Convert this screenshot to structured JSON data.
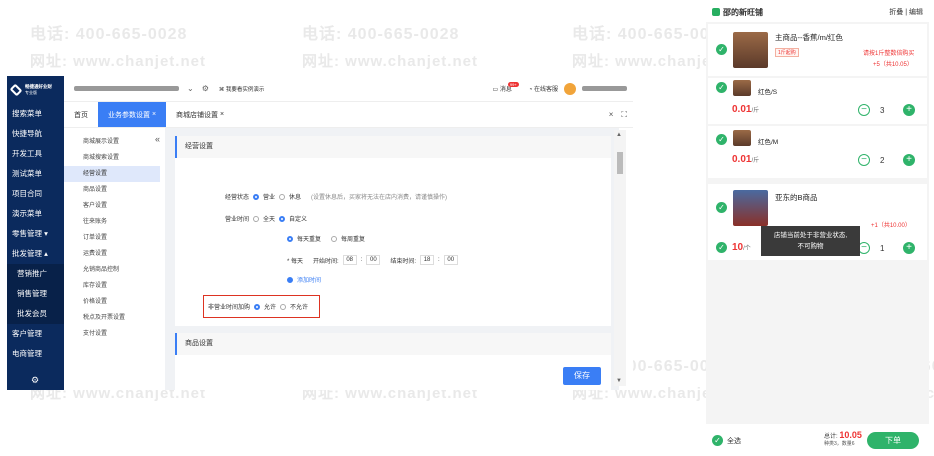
{
  "watermark": {
    "phone": "电话: 400-665-0028",
    "web": "网址: www.chanjet.net"
  },
  "app": {
    "logo_text": "畅捷通好业财",
    "logo_sub": "专业版",
    "nav": [
      "搜索菜单",
      "快捷导航",
      "开发工具",
      "测试菜单",
      "项目合同",
      "演示菜单",
      "零售管理",
      "批发管理",
      "营销推广",
      "销售管理",
      "批发会员",
      "客户管理",
      "电商管理"
    ],
    "nav_arrows": {
      "retail": "▾",
      "wholesale": "▴"
    },
    "topbar": {
      "example": "我要看实例演示",
      "msg": "消息",
      "badge": "99+",
      "service": "在线客服"
    },
    "tabs": [
      "首页",
      "业务参数设置",
      "商城店铺设置"
    ],
    "tab_close": "×",
    "submenu": [
      "商城展示设置",
      "商城搜索设置",
      "经营设置",
      "商品设置",
      "客户设置",
      "往来账务",
      "订单设置",
      "运费设置",
      "允销商品控制",
      "库存设置",
      "价格设置",
      "税点及开票设置",
      "支付设置"
    ],
    "active_sub": "经营设置",
    "collapse": "«",
    "section1_title": "经营设置",
    "status_label": "经营状态",
    "status_options": [
      "营业",
      "休息"
    ],
    "status_hint": "(设置休息后，买家将无法在店内消费，请谨慎操作)",
    "hours_label": "营业时间",
    "hours_options": [
      "全天",
      "自定义"
    ],
    "repeat_options": [
      "每天重复",
      "每周重复"
    ],
    "daily_prefix": "* 每天",
    "start_label": "开始时间:",
    "start_h": "08",
    "start_m": "00",
    "end_label": "结束时间:",
    "end_h": "18",
    "end_m": "00",
    "colon": ":",
    "add_time": "添加时间",
    "nonbiz_label": "非营业时间加购",
    "nonbiz_options": [
      "允许",
      "不允许"
    ],
    "section2_title": "商品设置",
    "save": "保存"
  },
  "mobile": {
    "shop": "邵的新旺铺",
    "ops": "折叠 | 编辑",
    "item1_name": "主商品--香蕉/m/红色",
    "item1_tag": "1斤起购",
    "item1_note": "请按1斤整数倍购买",
    "item1_sum": "+5（共10.05）",
    "sku1": {
      "name": "红色/S",
      "price": "0.01",
      "unit": "/斤",
      "qty": "3"
    },
    "sku2": {
      "name": "红色/M",
      "price": "0.01",
      "unit": "/斤",
      "qty": "2"
    },
    "item2_name": "亚东的B商品",
    "item2_sum": "+1（共10.00）",
    "item2_price": "10",
    "item2_unit": "/个",
    "item2_qty": "1",
    "toast": [
      "店铺当前处于非营业状态,",
      "不可购物"
    ],
    "select_all": "全选",
    "total_label": "总计:",
    "total": "10.05",
    "counts": "种类3，数量6",
    "order": "下单"
  },
  "colors": {
    "primary": "#3a7ef5",
    "nav_bg": "#0b2a5d",
    "green": "#2fb36a",
    "red": "#e33333"
  }
}
